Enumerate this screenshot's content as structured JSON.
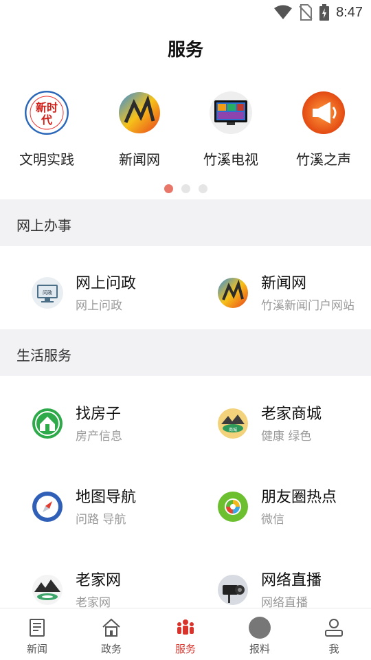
{
  "status": {
    "time": "8:47"
  },
  "header": {
    "title": "服务"
  },
  "quick_links": [
    {
      "label": "文明实践",
      "icon": "xinshidai-logo-icon"
    },
    {
      "label": "新闻网",
      "icon": "news-site-logo-icon"
    },
    {
      "label": "竹溪电视",
      "icon": "tv-icon"
    },
    {
      "label": "竹溪之声",
      "icon": "radio-horn-icon"
    }
  ],
  "pager": {
    "count": 3,
    "active": 1
  },
  "sections": {
    "online": {
      "title": "网上办事",
      "items": [
        {
          "title": "网上问政",
          "subtitle": "网上问政",
          "icon": "monitor-icon"
        },
        {
          "title": "新闻网",
          "subtitle": "竹溪新闻门户网站",
          "icon": "news-site-logo-icon"
        }
      ]
    },
    "life": {
      "title": "生活服务",
      "items": [
        {
          "title": "找房子",
          "subtitle": "房产信息",
          "icon": "house-icon"
        },
        {
          "title": "老家商城",
          "subtitle": "健康 绿色",
          "icon": "mall-logo-icon"
        },
        {
          "title": "地图导航",
          "subtitle": "问路 导航",
          "icon": "compass-icon"
        },
        {
          "title": "朋友圈热点",
          "subtitle": "微信",
          "icon": "moments-icon"
        },
        {
          "title": "老家网",
          "subtitle": "老家网",
          "icon": "hometown-logo-icon"
        },
        {
          "title": "网络直播",
          "subtitle": "网络直播",
          "icon": "live-camera-icon"
        }
      ]
    }
  },
  "tabs": [
    {
      "label": "新闻",
      "icon": "newspaper-icon",
      "active": false
    },
    {
      "label": "政务",
      "icon": "government-icon",
      "active": false
    },
    {
      "label": "服务",
      "icon": "people-icon",
      "active": true
    },
    {
      "label": "报料",
      "icon": "report-icon",
      "active": false
    },
    {
      "label": "我",
      "icon": "user-icon",
      "active": false
    }
  ],
  "colors": {
    "accent": "#d9342b",
    "pager_active": "#e8776a",
    "section_bg": "#f2f2f4"
  }
}
